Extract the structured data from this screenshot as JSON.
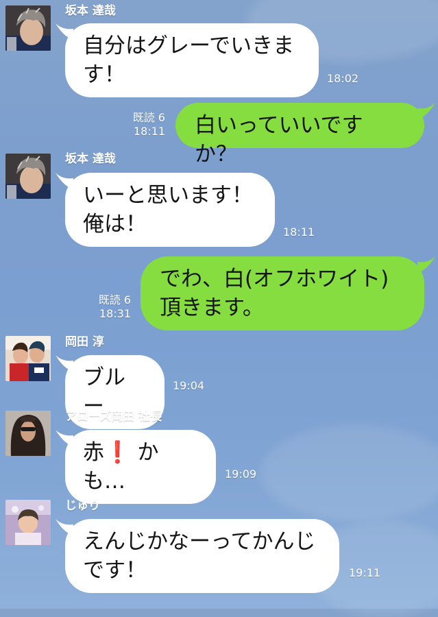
{
  "messages": [
    {
      "sender": "坂本 達哉",
      "text": "自分はグレーでいきます！",
      "time": "18:02",
      "direction": "incoming",
      "avatar": "avatar-sakamoto"
    },
    {
      "read": "既読 6",
      "text": "白いっていいですか？",
      "time": "18:11",
      "direction": "outgoing"
    },
    {
      "sender": "坂本 達哉",
      "text": "いーと思います！ 俺は！",
      "time": "18:11",
      "direction": "incoming",
      "avatar": "avatar-sakamoto"
    },
    {
      "read": "既読 6",
      "text": "でわ、白(オフホワイト)頂きます。",
      "time": "18:31",
      "direction": "outgoing"
    },
    {
      "sender": "岡田 淳",
      "text": "ブルー",
      "time": "19:04",
      "direction": "incoming",
      "avatar": "avatar-okada"
    },
    {
      "sender": "アローズ岡田 社長",
      "text_before": "赤",
      "emoji": "❗",
      "text_after": " かも…",
      "time": "19:09",
      "direction": "incoming",
      "avatar": "avatar-arrows"
    },
    {
      "sender": "じゅり",
      "text": "えんじかなーってかんじです！",
      "time": "19:11",
      "direction": "incoming",
      "avatar": "avatar-juri"
    }
  ],
  "colors": {
    "background": "#7b9fd0",
    "incoming_bubble": "#ffffff",
    "outgoing_bubble": "#86dd3f",
    "meta_text": "#ffffff",
    "exclamation": "#e11b1b"
  }
}
